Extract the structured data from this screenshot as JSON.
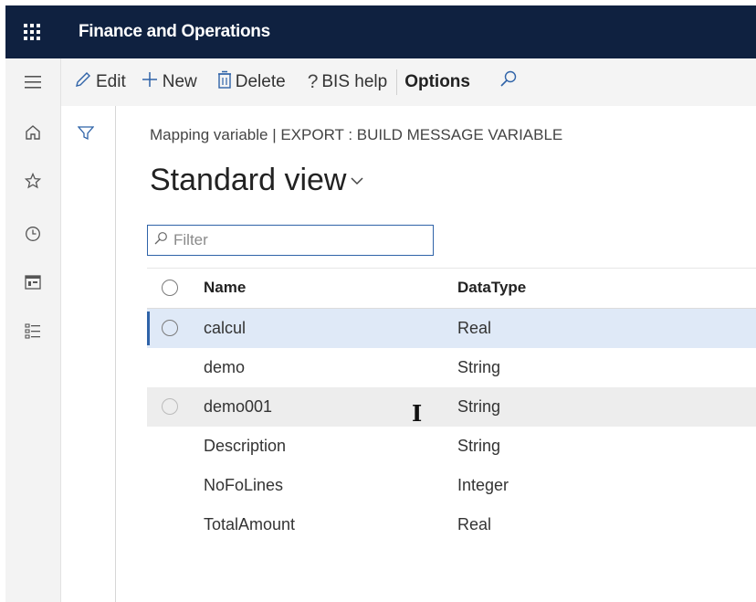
{
  "app": {
    "title": "Finance and Operations"
  },
  "actions": {
    "edit": "Edit",
    "new": "New",
    "delete": "Delete",
    "help": "BIS help",
    "options": "Options"
  },
  "nav": {
    "icons": [
      "menu-icon",
      "home-icon",
      "star-icon",
      "clock-icon",
      "workspace-icon",
      "list-icon"
    ]
  },
  "page": {
    "breadcrumb": "Mapping variable  |  EXPORT : BUILD MESSAGE VARIABLE",
    "view_title": "Standard view",
    "filter_placeholder": "Filter"
  },
  "grid": {
    "columns": {
      "name": "Name",
      "datatype": "DataType"
    },
    "rows": [
      {
        "name": "calcul",
        "datatype": "Real",
        "state": "selected"
      },
      {
        "name": "demo",
        "datatype": "String",
        "state": ""
      },
      {
        "name": "demo001",
        "datatype": "String",
        "state": "hover"
      },
      {
        "name": "Description",
        "datatype": "String",
        "state": ""
      },
      {
        "name": "NoFoLines",
        "datatype": "Integer",
        "state": ""
      },
      {
        "name": "TotalAmount",
        "datatype": "Real",
        "state": ""
      }
    ]
  },
  "colors": {
    "topbar": "#0f2140",
    "accent": "#2f63a8",
    "selected_row": "#dfe9f7"
  }
}
